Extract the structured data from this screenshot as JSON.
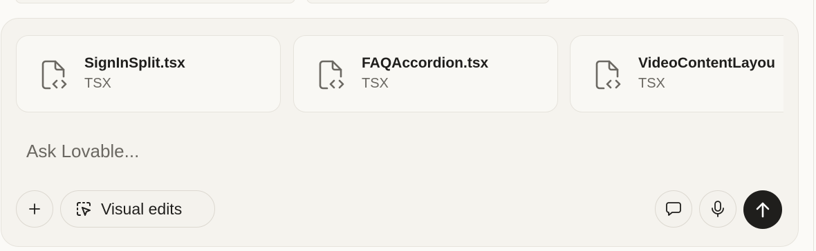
{
  "composer": {
    "placeholder": "Ask Lovable...",
    "attachments": [
      {
        "name": "SignInSplit.tsx",
        "type": "TSX",
        "icon": "code-file-icon"
      },
      {
        "name": "FAQAccordion.tsx",
        "type": "TSX",
        "icon": "code-file-icon"
      },
      {
        "name": "VideoContentLayou",
        "type": "TSX",
        "icon": "code-file-icon"
      }
    ],
    "toolbar": {
      "add_icon": "plus-icon",
      "visual_edits_label": "Visual edits",
      "visual_edits_icon": "cursor-select-icon",
      "chat_icon": "chat-bubble-icon",
      "mic_icon": "microphone-icon",
      "send_icon": "arrow-up-icon"
    }
  },
  "colors": {
    "background": "#fbfaf7",
    "composer_bg": "#f5f3ee",
    "card_bg": "#f9f8f4",
    "border": "#e6e3dc",
    "text": "#1f1e1c",
    "muted_text": "#6b6862",
    "send_bg": "#1f1e1c"
  }
}
